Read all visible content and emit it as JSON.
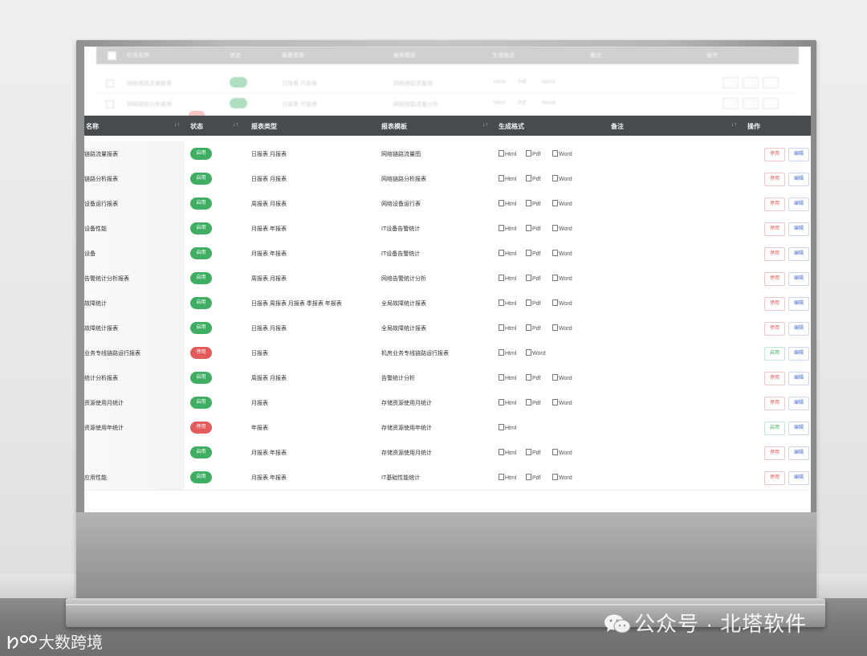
{
  "back_table": {
    "headers": [
      "任务名称",
      "状态",
      "报表类型",
      "报表模板",
      "生成格式",
      "备注",
      "操作"
    ],
    "rows": [
      {
        "name": "网络链路流量报表",
        "type": "日报表 月报表",
        "template": "网络链路流量图",
        "formats": [
          "Html",
          "Pdf",
          "Word"
        ]
      },
      {
        "name": "网络链路分析报表",
        "type": "日报表 月报表",
        "template": "网络链路流量分析",
        "formats": [
          "Html",
          "Pdf",
          "Word"
        ]
      }
    ]
  },
  "table": {
    "headers": {
      "name": "名称",
      "status": "状态",
      "report_type": "报表类型",
      "template": "报表模板",
      "format": "生成格式",
      "remark": "备注",
      "action": "操作"
    },
    "sort_glyph": "↓↑",
    "rows": [
      {
        "name": "链路流量报表",
        "status": "启用",
        "active": true,
        "type": "日报表 月报表",
        "template": "网络链路流量图",
        "formats": [
          "Html",
          "Pdf",
          "Word"
        ],
        "toggle": "停用",
        "edit": "编辑"
      },
      {
        "name": "链路分析报表",
        "status": "启用",
        "active": true,
        "type": "日报表 月报表",
        "template": "网络链路分析报表",
        "formats": [
          "Html",
          "Pdf",
          "Word"
        ],
        "toggle": "停用",
        "edit": "编辑"
      },
      {
        "name": "设备运行报表",
        "status": "启用",
        "active": true,
        "type": "周报表 月报表",
        "template": "网络设备运行表",
        "formats": [
          "Html",
          "Pdf",
          "Word"
        ],
        "toggle": "停用",
        "edit": "编辑"
      },
      {
        "name": "设备性能",
        "status": "启用",
        "active": true,
        "type": "月报表 年报表",
        "template": "IT设备告警统计",
        "formats": [
          "Html",
          "Pdf",
          "Word"
        ],
        "toggle": "停用",
        "edit": "编辑"
      },
      {
        "name": "设备",
        "status": "启用",
        "active": true,
        "type": "月报表 年报表",
        "template": "IT设备告警统计",
        "formats": [
          "Html",
          "Pdf",
          "Word"
        ],
        "toggle": "停用",
        "edit": "编辑"
      },
      {
        "name": "告警统计分析报表",
        "status": "启用",
        "active": true,
        "type": "周报表 月报表",
        "template": "网络告警统计分析",
        "formats": [
          "Html",
          "Pdf",
          "Word"
        ],
        "toggle": "停用",
        "edit": "编辑"
      },
      {
        "name": "故障统计",
        "status": "启用",
        "active": true,
        "type": "日报表 周报表 月报表 季报表 年报表",
        "template": "全局故障统计报表",
        "formats": [
          "Html",
          "Pdf",
          "Word"
        ],
        "toggle": "停用",
        "edit": "编辑"
      },
      {
        "name": "故障统计报表",
        "status": "启用",
        "active": true,
        "type": "日报表 月报表",
        "template": "全局故障统计报表",
        "formats": [
          "Html",
          "Pdf",
          "Word"
        ],
        "toggle": "停用",
        "edit": "编辑"
      },
      {
        "name": "业务专线链路运行报表",
        "status": "停用",
        "active": false,
        "type": "日报表",
        "template": "机房业务专线链路运行报表",
        "formats": [
          "Html",
          "Word"
        ],
        "toggle": "启用",
        "edit": "编辑"
      },
      {
        "name": "统计分析报表",
        "status": "启用",
        "active": true,
        "type": "周报表 月报表",
        "template": "告警统计分析",
        "formats": [
          "Html",
          "Pdf",
          "Word"
        ],
        "toggle": "停用",
        "edit": "编辑"
      },
      {
        "name": "资源使用月统计",
        "status": "启用",
        "active": true,
        "type": "月报表",
        "template": "存储资源使用月统计",
        "formats": [
          "Html",
          "Pdf",
          "Word"
        ],
        "toggle": "停用",
        "edit": "编辑"
      },
      {
        "name": "资源使用年统计",
        "status": "停用",
        "active": false,
        "type": "年报表",
        "template": "存储资源使用年统计",
        "formats": [
          "Html"
        ],
        "toggle": "启用",
        "edit": "编辑"
      },
      {
        "name": "",
        "status": "启用",
        "active": true,
        "type": "月报表 年报表",
        "template": "存储资源使用月统计",
        "formats": [
          "Html",
          "Pdf",
          "Word"
        ],
        "toggle": "停用",
        "edit": "编辑"
      },
      {
        "name": "应用性能",
        "status": "启用",
        "active": true,
        "type": "月报表 年报表",
        "template": "IT基础性能统计",
        "formats": [
          "Html",
          "Pdf",
          "Word"
        ],
        "toggle": "停用",
        "edit": "编辑"
      }
    ]
  },
  "watermark": {
    "right": "公众号 · 北塔软件",
    "left": "大数跨境"
  },
  "icons": {
    "format": "file-icon",
    "wechat": "wechat-icon",
    "logo": "brand-logo-icon"
  },
  "colors": {
    "active": "#3fae62",
    "inactive": "#e35b5b",
    "header": "#474b4f",
    "edit": "#4a6fd1"
  }
}
